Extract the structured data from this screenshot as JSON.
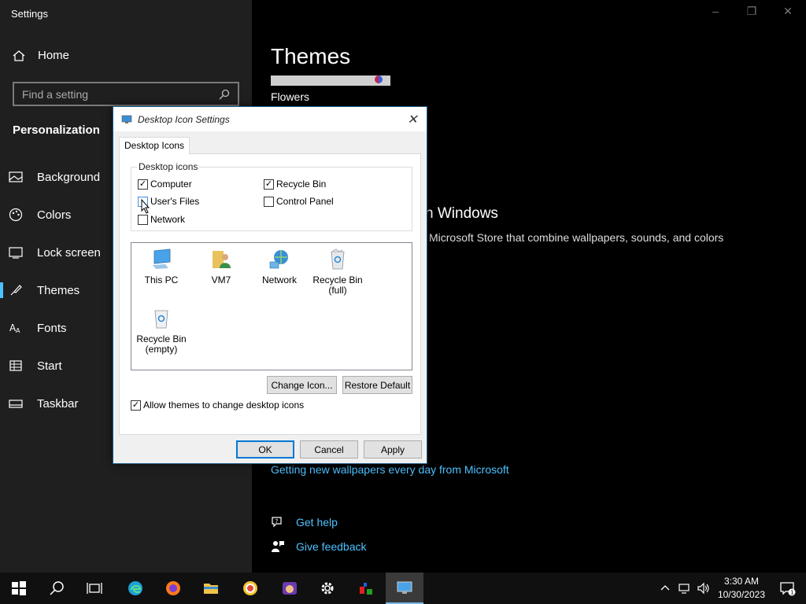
{
  "app": {
    "title": "Settings"
  },
  "sidebar": {
    "home": "Home",
    "search_placeholder": "Find a setting",
    "section": "Personalization",
    "items": [
      {
        "label": "Background",
        "icon": "image-icon"
      },
      {
        "label": "Colors",
        "icon": "palette-icon"
      },
      {
        "label": "Lock screen",
        "icon": "lock-screen-icon"
      },
      {
        "label": "Themes",
        "icon": "themes-icon",
        "active": true
      },
      {
        "label": "Fonts",
        "icon": "fonts-icon"
      },
      {
        "label": "Start",
        "icon": "start-icon"
      },
      {
        "label": "Taskbar",
        "icon": "taskbar-icon"
      }
    ]
  },
  "content": {
    "title": "Themes",
    "theme_name": "Flowers",
    "ms_heading": "n Windows",
    "ms_desc": "Microsoft Store that combine wallpapers, sounds, and colors",
    "wallpaper_link": "Getting new wallpapers every day from Microsoft",
    "help": "Get help",
    "feedback": "Give feedback"
  },
  "dialog": {
    "title": "Desktop Icon Settings",
    "tab": "Desktop Icons",
    "group_label": "Desktop icons",
    "checkboxes": [
      {
        "label": "Computer",
        "checked": true
      },
      {
        "label": "Recycle Bin",
        "checked": true
      },
      {
        "label": "User's Files",
        "checked": false
      },
      {
        "label": "Control Panel",
        "checked": false
      },
      {
        "label": "Network",
        "checked": false
      }
    ],
    "icons": [
      {
        "label": "This PC"
      },
      {
        "label": "VM7"
      },
      {
        "label": "Network"
      },
      {
        "label": "Recycle Bin (full)"
      },
      {
        "label": "Recycle Bin (empty)"
      }
    ],
    "change_icon": "Change Icon...",
    "restore_default": "Restore Default",
    "allow_themes": "Allow themes to change desktop icons",
    "allow_themes_checked": true,
    "ok": "OK",
    "cancel": "Cancel",
    "apply": "Apply"
  },
  "taskbar": {
    "time": "3:30 AM",
    "date": "10/30/2023",
    "notification_count": "1"
  },
  "colors": {
    "accent": "#4cc2ff",
    "sidebar_bg": "#1f1f1f",
    "dialog_border": "#1a5d8a"
  }
}
